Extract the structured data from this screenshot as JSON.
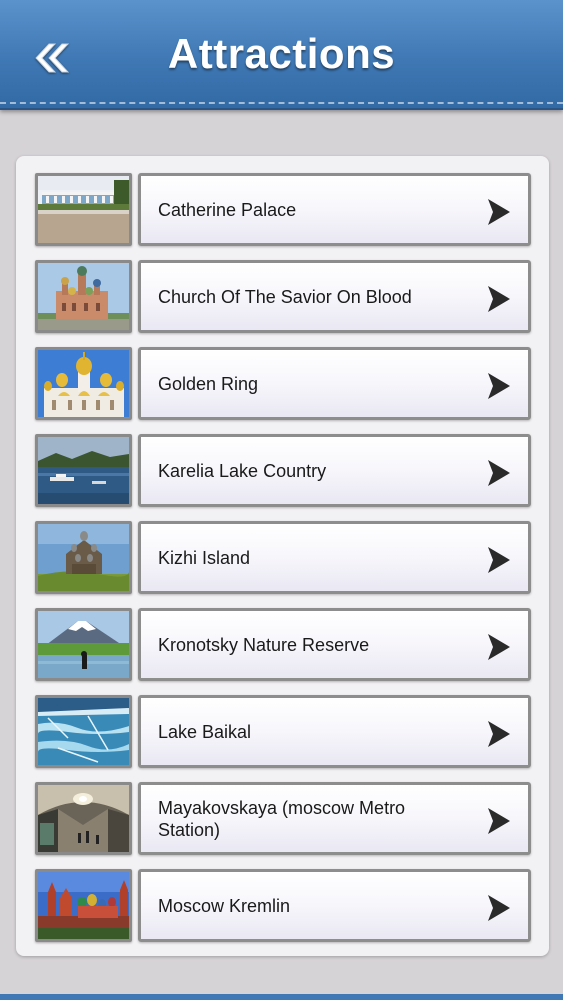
{
  "header": {
    "title": "Attractions",
    "back_icon": "double-chevron-left-icon"
  },
  "colors": {
    "header_blue": "#3f78b4",
    "background": "#d6d3d7",
    "arrow": "#2a2a2a"
  },
  "list": {
    "items": [
      {
        "label": "Catherine Palace",
        "thumb": "palace-photo",
        "arrow_icon": "chevron-right-icon"
      },
      {
        "label": "Church Of The Savior On Blood",
        "thumb": "church-photo",
        "arrow_icon": "chevron-right-icon"
      },
      {
        "label": "Golden Ring",
        "thumb": "golden-domes-photo",
        "arrow_icon": "chevron-right-icon"
      },
      {
        "label": "Karelia Lake Country",
        "thumb": "lake-photo",
        "arrow_icon": "chevron-right-icon"
      },
      {
        "label": "Kizhi Island",
        "thumb": "wooden-church-photo",
        "arrow_icon": "chevron-right-icon"
      },
      {
        "label": "Kronotsky Nature Reserve",
        "thumb": "volcano-photo",
        "arrow_icon": "chevron-right-icon"
      },
      {
        "label": "Lake Baikal",
        "thumb": "frozen-lake-photo",
        "arrow_icon": "chevron-right-icon"
      },
      {
        "label": "Mayakovskaya (moscow Metro Station)",
        "thumb": "metro-hall-photo",
        "arrow_icon": "chevron-right-icon"
      },
      {
        "label": "Moscow Kremlin",
        "thumb": "kremlin-photo",
        "arrow_icon": "chevron-right-icon"
      }
    ]
  }
}
